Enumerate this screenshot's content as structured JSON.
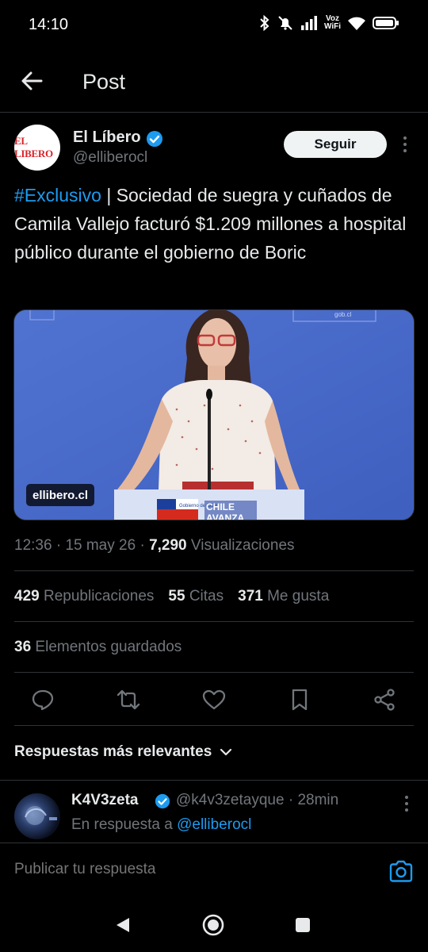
{
  "status": {
    "time": "14:10",
    "voz_line1": "Voz",
    "voz_line2": "WiFi"
  },
  "header": {
    "title": "Post"
  },
  "post": {
    "author_name": "El Líbero",
    "author_handle": "@elliberocl",
    "avatar_text": "EL LIBERO",
    "follow_label": "Seguir",
    "hashtag": "#Exclusivo",
    "text": " | Sociedad de suegra y cuñados de Camila Vallejo facturó $1.209 millones a hospital público durante el gobierno de Boric",
    "image_badge": "ellibero.cl",
    "image_podium_line1": "CHILE",
    "image_podium_line2": "AVANZA",
    "image_podium_gov": "Gobierno de Chile",
    "image_backdrop": "gob.cl",
    "time": "12:36",
    "date": "15 may 26",
    "views": "7,290",
    "views_label": "Visualizaciones",
    "reposts": "429",
    "reposts_label": "Republicaciones",
    "quotes": "55",
    "quotes_label": "Citas",
    "likes": "371",
    "likes_label": "Me gusta",
    "bookmarks": "36",
    "bookmarks_label": "Elementos guardados"
  },
  "replies": {
    "header": "Respuestas más relevantes",
    "first": {
      "name": "K4V3zeta",
      "handle": "@k4v3zetayque",
      "age": "28min",
      "reply_to_prefix": "En respuesta a ",
      "reply_to_handle": "@elliberocl"
    }
  },
  "compose": {
    "placeholder": "Publicar tu respuesta"
  },
  "colors": {
    "accent": "#1d9bf0",
    "background": "#000000",
    "muted": "#71767b"
  }
}
